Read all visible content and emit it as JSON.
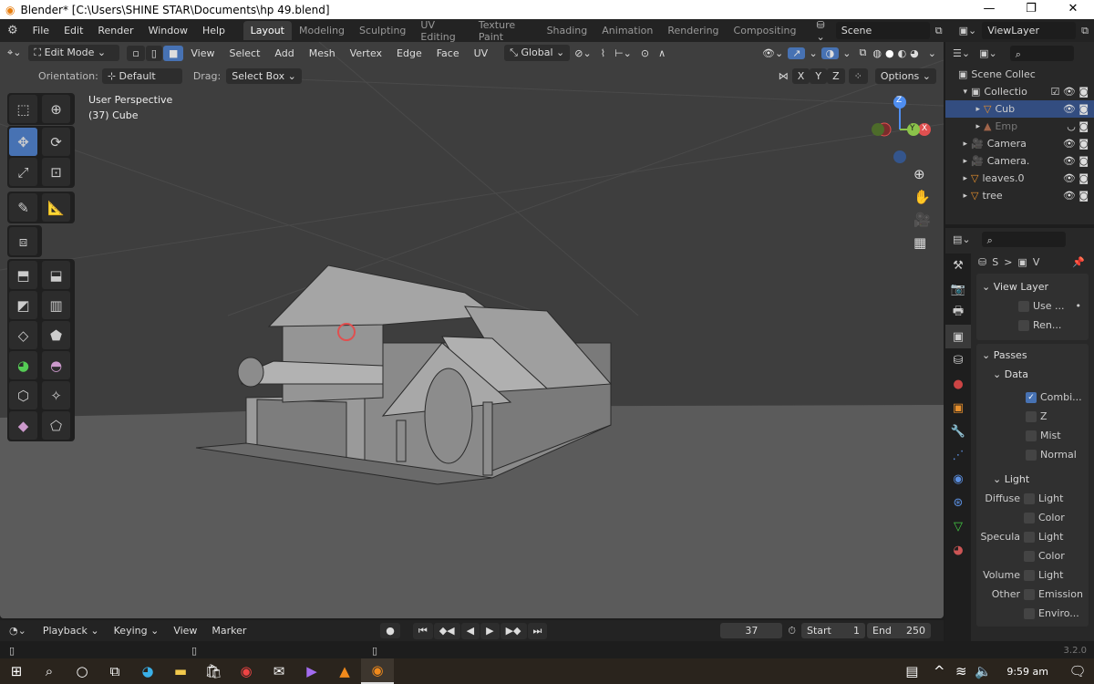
{
  "window": {
    "title": "Blender* [C:\\Users\\SHINE STAR\\Documents\\hp 49.blend]"
  },
  "menu": [
    "File",
    "Edit",
    "Render",
    "Window",
    "Help"
  ],
  "workspaces": [
    "Layout",
    "Modeling",
    "Sculpting",
    "UV Editing",
    "Texture Paint",
    "Shading",
    "Animation",
    "Rendering",
    "Compositing"
  ],
  "scene": "Scene",
  "view_layer": "ViewLayer",
  "viewport": {
    "mode": "Edit Mode",
    "menus": [
      "View",
      "Select",
      "Add",
      "Mesh",
      "Vertex",
      "Edge",
      "Face",
      "UV"
    ],
    "transform": "Global",
    "orientation_label": "Orientation:",
    "orientation": "Default",
    "drag_label": "Drag:",
    "drag": "Select Box",
    "axes": [
      "X",
      "Y",
      "Z"
    ],
    "options": "Options",
    "perspective": "User Perspective",
    "object": "(37) Cube",
    "gizmo": {
      "z": "Z",
      "y": "Y",
      "x": "X"
    },
    "accent": "#4772b3"
  },
  "outliner": {
    "items": [
      {
        "name": "Scene Collec",
        "icon": "collection-icon",
        "indent": 0
      },
      {
        "name": "Collectio",
        "icon": "collection-icon",
        "indent": 1,
        "checked": true
      },
      {
        "name": "Cub",
        "icon": "mesh-icon",
        "indent": 2,
        "selected": true
      },
      {
        "name": "Emp",
        "icon": "image-empty-icon",
        "indent": 2,
        "dim": true
      },
      {
        "name": "Camera",
        "icon": "camera-icon",
        "indent": 1
      },
      {
        "name": "Camera.",
        "icon": "camera-icon",
        "indent": 1
      },
      {
        "name": "leaves.0",
        "icon": "mesh-icon",
        "indent": 1
      },
      {
        "name": "tree",
        "icon": "mesh-icon",
        "indent": 1
      }
    ]
  },
  "properties": {
    "breadcrumb": [
      "S",
      ">",
      "V"
    ],
    "view_layer": {
      "title": "View Layer",
      "use": "Use ...",
      "render": "Ren..."
    },
    "passes": {
      "title": "Passes",
      "data": "Data",
      "items": [
        {
          "label": "Combi...",
          "on": true
        },
        {
          "label": "Z"
        },
        {
          "label": "Mist"
        },
        {
          "label": "Normal"
        }
      ]
    },
    "light": {
      "title": "Light",
      "rows": [
        {
          "label": "Diffuse",
          "opt": "Light"
        },
        {
          "label": "",
          "opt": "Color"
        },
        {
          "label": "Specula",
          "opt": "Light"
        },
        {
          "label": "",
          "opt": "Color"
        },
        {
          "label": "Volume",
          "opt": "Light"
        },
        {
          "label": "Other",
          "opt": "Emission"
        },
        {
          "label": "",
          "opt": "Enviro..."
        }
      ]
    }
  },
  "timeline": {
    "menus": [
      "Playback",
      "Keying",
      "View",
      "Marker"
    ],
    "frame": "37",
    "start_label": "Start",
    "start": "1",
    "end_label": "End",
    "end": "250"
  },
  "status": {
    "version": "3.2.0"
  },
  "taskbar": {
    "time": "9:59 am"
  }
}
